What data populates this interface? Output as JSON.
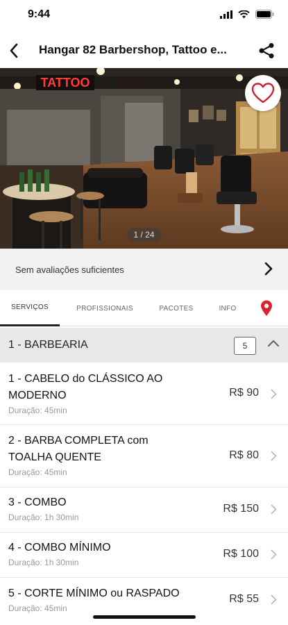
{
  "status": {
    "time": "9:44"
  },
  "nav": {
    "title": "Hangar 82 Barbershop, Tattoo e..."
  },
  "hero": {
    "sign_text": "TATTOO",
    "counter": "1 / 24"
  },
  "reviews": {
    "text": "Sem avaliações suficientes"
  },
  "tabs": {
    "servicos": "SERVIÇOS",
    "profissionais": "PROFISSIONAIS",
    "pacotes": "PACOTES",
    "info": "INFO"
  },
  "section": {
    "title": "1 - BARBEARIA",
    "count": "5"
  },
  "services": [
    {
      "name": "1 - CABELO do CLÁSSICO AO MODERNO",
      "duration": "Duração: 45min",
      "price": "R$ 90"
    },
    {
      "name": "2 - BARBA COMPLETA com TOALHA QUENTE",
      "duration": "Duração: 45min",
      "price": "R$ 80"
    },
    {
      "name": "3 - COMBO",
      "duration": "Duração: 1h 30min",
      "price": "R$ 150"
    },
    {
      "name": "4 - COMBO MÍNIMO",
      "duration": "Duração: 1h 30min",
      "price": "R$ 100"
    },
    {
      "name": "5 - CORTE MÍNIMO ou RASPADO",
      "duration": "Duração: 45min",
      "price": "R$ 55"
    }
  ],
  "colors": {
    "accent_red": "#d0222e",
    "map_pin": "#e0202c"
  },
  "icons": [
    "back-arrow-icon",
    "share-icon",
    "heart-icon",
    "chevron-right-icon",
    "map-pin-icon",
    "chevron-up-icon",
    "signal-icon",
    "wifi-icon",
    "battery-icon"
  ]
}
